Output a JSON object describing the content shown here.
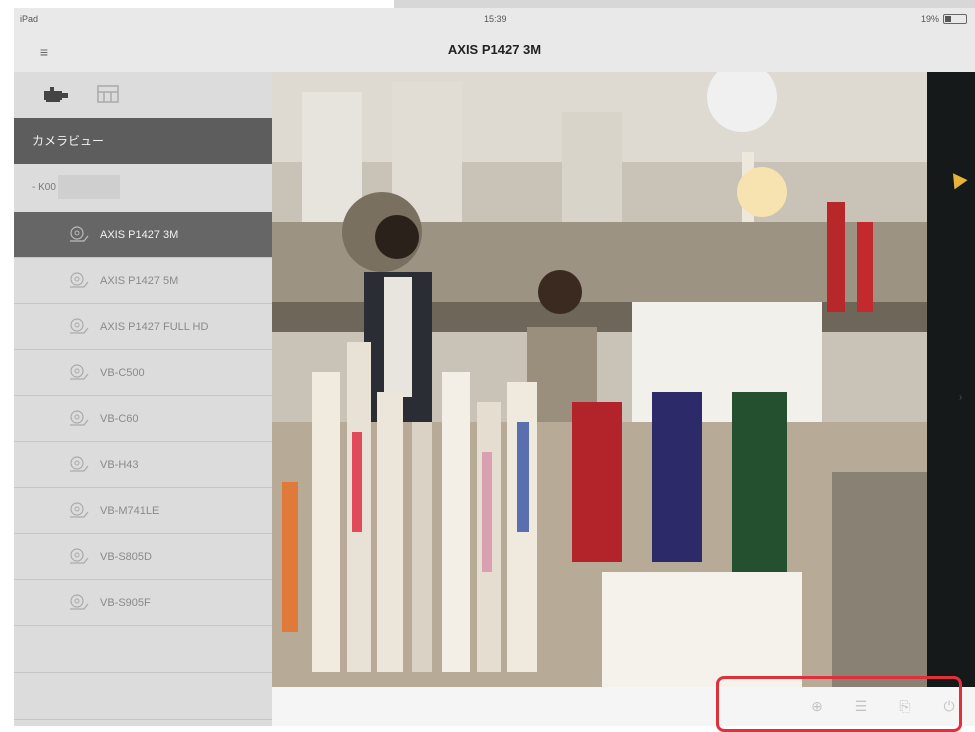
{
  "status_bar": {
    "carrier": "iPad",
    "time": "15:39",
    "battery": "19%"
  },
  "nav": {
    "title": "AXIS P1427 3M",
    "menu_icon": "hamburger-icon"
  },
  "sidebar": {
    "tabs": [
      {
        "icon": "camera-icon"
      },
      {
        "icon": "layout-grid-icon"
      }
    ],
    "section_title": "カメラビュー",
    "group_label": "- K00",
    "cameras": [
      {
        "label": "AXIS P1427 3M",
        "selected": true
      },
      {
        "label": "AXIS P1427 5M",
        "selected": false
      },
      {
        "label": "AXIS P1427 FULL HD",
        "selected": false
      },
      {
        "label": "VB-C500",
        "selected": false
      },
      {
        "label": "VB-C60",
        "selected": false
      },
      {
        "label": "VB-H43",
        "selected": false
      },
      {
        "label": "VB-M741LE",
        "selected": false
      },
      {
        "label": "VB-S805D",
        "selected": false
      },
      {
        "label": "VB-S905F",
        "selected": false
      }
    ]
  },
  "toolbar": {
    "buttons": [
      {
        "icon": "ptz-control-icon"
      },
      {
        "icon": "preset-list-icon"
      },
      {
        "icon": "io-control-icon"
      },
      {
        "icon": "power-icon"
      }
    ]
  },
  "colors": {
    "selected_row": "#666666",
    "section_header": "#5d5d5d",
    "highlight_box": "#e0303a"
  }
}
